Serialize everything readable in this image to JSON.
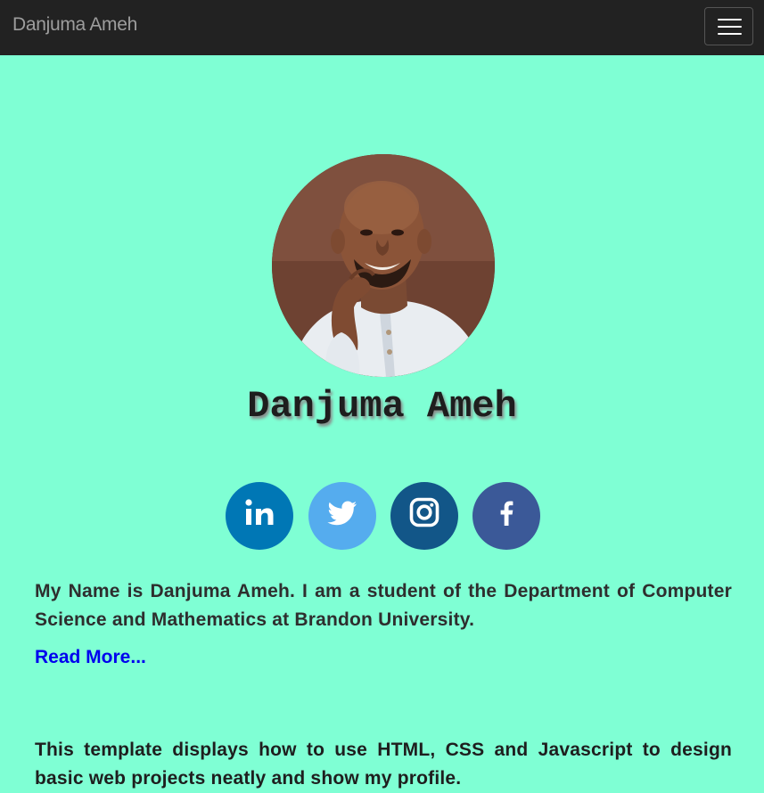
{
  "navbar": {
    "brand": "Danjuma Ameh",
    "toggle_icon": "hamburger-menu-icon"
  },
  "profile": {
    "photo_alt": "Danjuma Ameh",
    "name": "Danjuma Ameh"
  },
  "social": [
    {
      "name": "linkedin",
      "icon": "linkedin-icon",
      "color": "#0077b5"
    },
    {
      "name": "twitter",
      "icon": "twitter-icon",
      "color": "#55acee"
    },
    {
      "name": "instagram",
      "icon": "instagram-icon",
      "color": "#125688"
    },
    {
      "name": "facebook",
      "icon": "facebook-icon",
      "color": "#3b5998"
    }
  ],
  "intro": {
    "text": "My Name is Danjuma Ameh. I am a student of the Department of Computer Science and Mathematics at Brandon University.",
    "read_more": "Read More..."
  },
  "note": {
    "text": "This template displays how to use HTML, CSS and Javascript to design basic web projects neatly and show my profile."
  },
  "colors": {
    "page_background": "#7fffd4",
    "navbar_background": "#222222",
    "link": "#0000ee"
  }
}
